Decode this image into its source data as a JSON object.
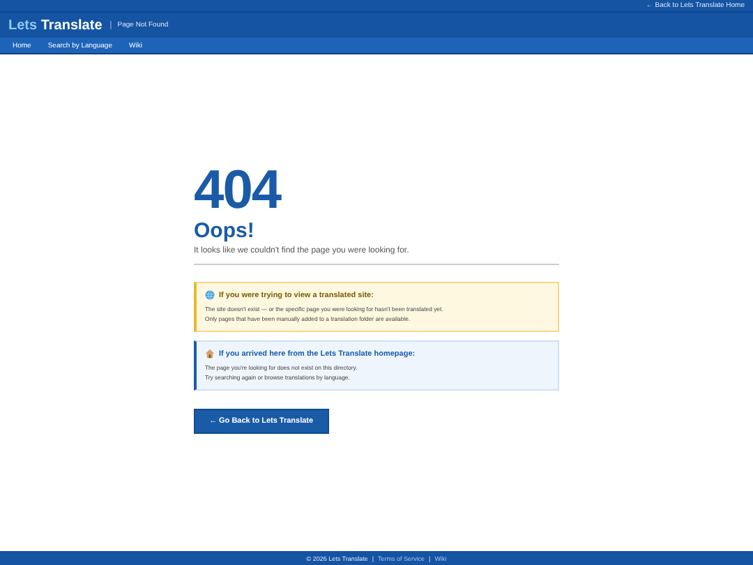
{
  "top_bar": {
    "link": "← Back to Lets Translate Home"
  },
  "header": {
    "logo_part_1": "Lets",
    "logo_part_2": "Translate",
    "subtitle": "Page Not Found"
  },
  "nav": [
    "Home",
    "Search by Language",
    "Wiki"
  ],
  "error": {
    "code": "404",
    "title": "Oops!",
    "message": "It looks like we couldn't find the page you were looking for."
  },
  "notices": [
    {
      "kind": "warning",
      "heading": "If you were trying to view a translated site:",
      "lines": [
        "The site doesn't exist — or the specific page you were looking for hasn't been translated yet.",
        "Only pages that have been manually added to a translation folder are available."
      ]
    },
    {
      "kind": "info",
      "heading": "If you arrived here from the Lets Translate homepage:",
      "lines": [
        "The page you're looking for does not exist on this directory.",
        "Try searching again or browse translations by language."
      ]
    }
  ],
  "button": "← Go Back to Lets Translate",
  "footer": {
    "separator": "|",
    "items": [
      "© 2026 Lets Translate",
      "Terms of Service",
      "Wiki"
    ]
  }
}
